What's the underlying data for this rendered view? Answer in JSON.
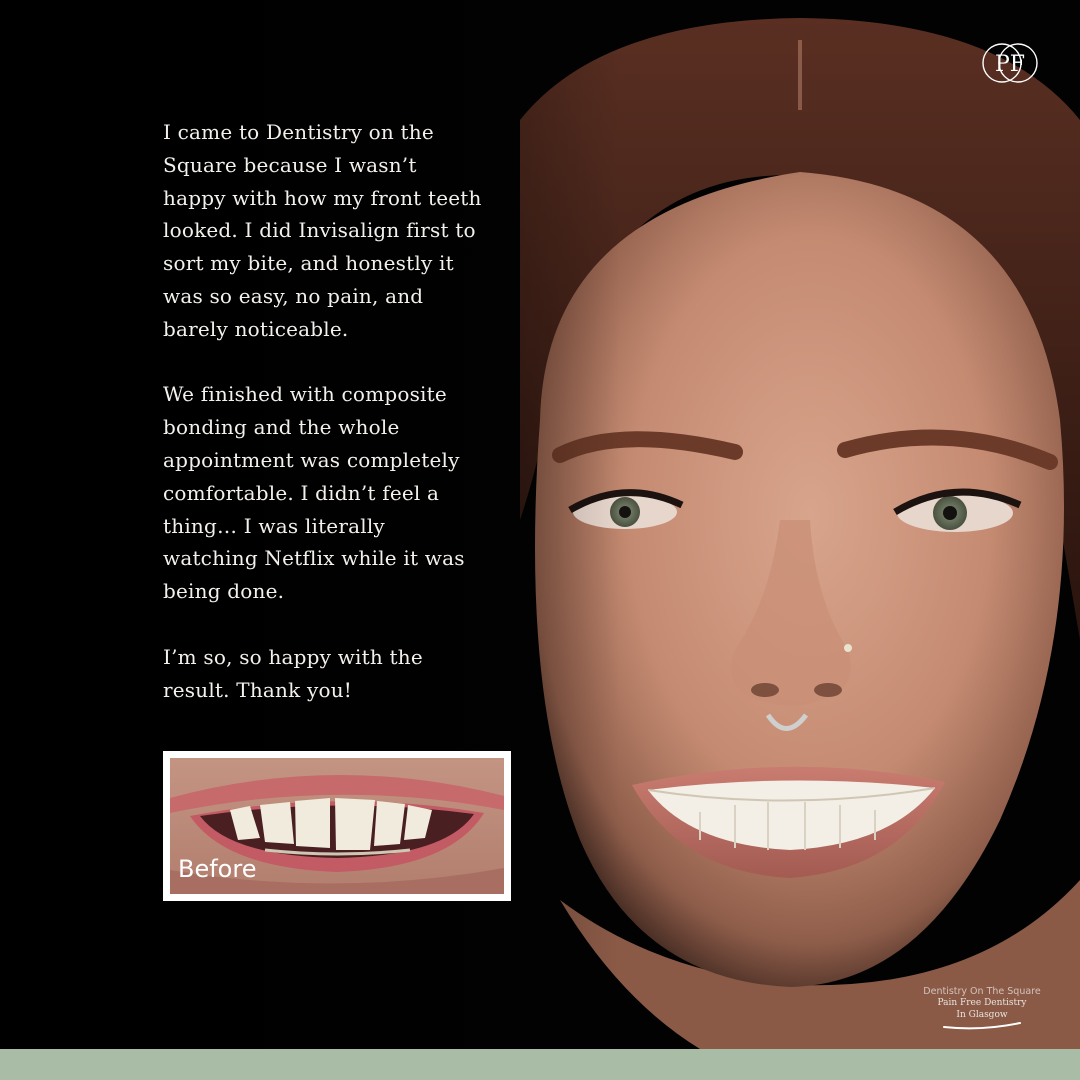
{
  "testimonial": {
    "paragraphs": [
      "I came to Dentistry on the Square because I wasn’t happy with how my front teeth looked. I did Invisalign first to sort my bite, and honestly it was so easy, no pain, and barely noticeable.",
      "We finished with composite bonding and the whole appointment was completely comfortable. I didn’t feel a thing… I was literally watching Netflix while it was being done.",
      "I’m so, so happy with the result. Thank you!"
    ]
  },
  "before_photo": {
    "label": "Before"
  },
  "logo": {
    "monogram": "PF"
  },
  "watermark": {
    "brand": "Dentistry On The Square",
    "tagline_1": "Pain Free Dentistry",
    "tagline_2": "In Glasgow"
  },
  "colors": {
    "background": "#000000",
    "text": "#f4f1ec",
    "bottom_bar": "#a9bca6",
    "frame": "#ffffff"
  }
}
